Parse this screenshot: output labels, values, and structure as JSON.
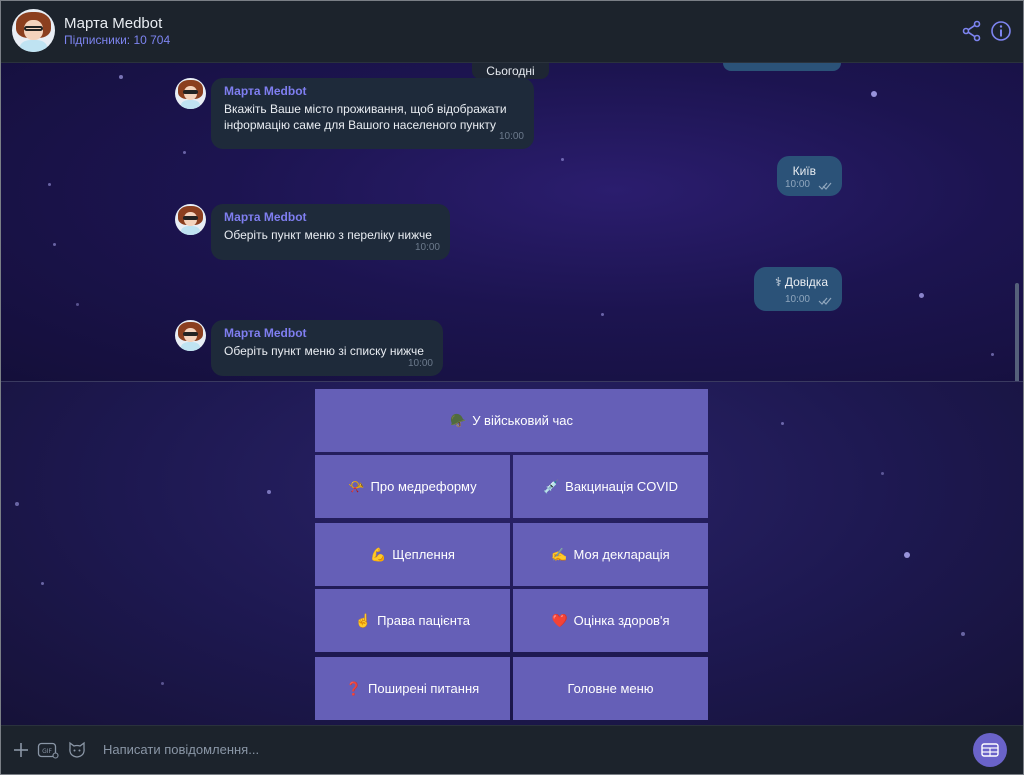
{
  "header": {
    "title": "Марта Medbot",
    "subscribers": "Підписники: 10 704",
    "share_icon": "share-icon",
    "info_icon": "info-icon"
  },
  "chat": {
    "date_label": "Сьогодні",
    "messages": [
      {
        "direction": "in",
        "sender": "Марта Medbot",
        "text": "Вкажіть Ваше місто проживання, щоб відображати\nінформацію саме для Вашого населеного пункту",
        "time": "10:00"
      },
      {
        "direction": "out",
        "text": "Київ",
        "time": "10:00",
        "status": "read"
      },
      {
        "direction": "in",
        "sender": "Марта Medbot",
        "text": "Оберіть пункт меню з переліку нижче",
        "time": "10:00"
      },
      {
        "direction": "out",
        "text": "⚕ Довідка",
        "time": "10:00",
        "status": "read"
      },
      {
        "direction": "in",
        "sender": "Марта Medbot",
        "text": "Оберіть пункт меню зі списку нижче",
        "time": "10:00"
      }
    ]
  },
  "keyboard": {
    "buttons": [
      {
        "emoji": "🪖",
        "label": "У військовий час"
      },
      {
        "emoji": "📯",
        "label": "Про медреформу"
      },
      {
        "emoji": "💉",
        "label": "Вакцинація COVID"
      },
      {
        "emoji": "💪",
        "label": "Щеплення"
      },
      {
        "emoji": "✍️",
        "label": "Моя декларація"
      },
      {
        "emoji": "☝️",
        "label": "Права пацієнта"
      },
      {
        "emoji": "❤️",
        "label": "Оцінка здоров'я"
      },
      {
        "emoji": "❓",
        "label": "Поширені питання"
      },
      {
        "emoji": "",
        "label": "Головне меню"
      }
    ],
    "button_color": "#655fb7"
  },
  "input": {
    "placeholder": "Написати повідомлення...",
    "attach_icon": "plus-icon",
    "gif_icon": "gif-icon",
    "sticker_icon": "sticker-icon",
    "keyboard_toggle_icon": "bot-keyboard-icon"
  },
  "colors": {
    "accent": "#7d84f0",
    "outgoing_bubble": "#2b5278",
    "incoming_bubble": "#1e2a3a"
  }
}
